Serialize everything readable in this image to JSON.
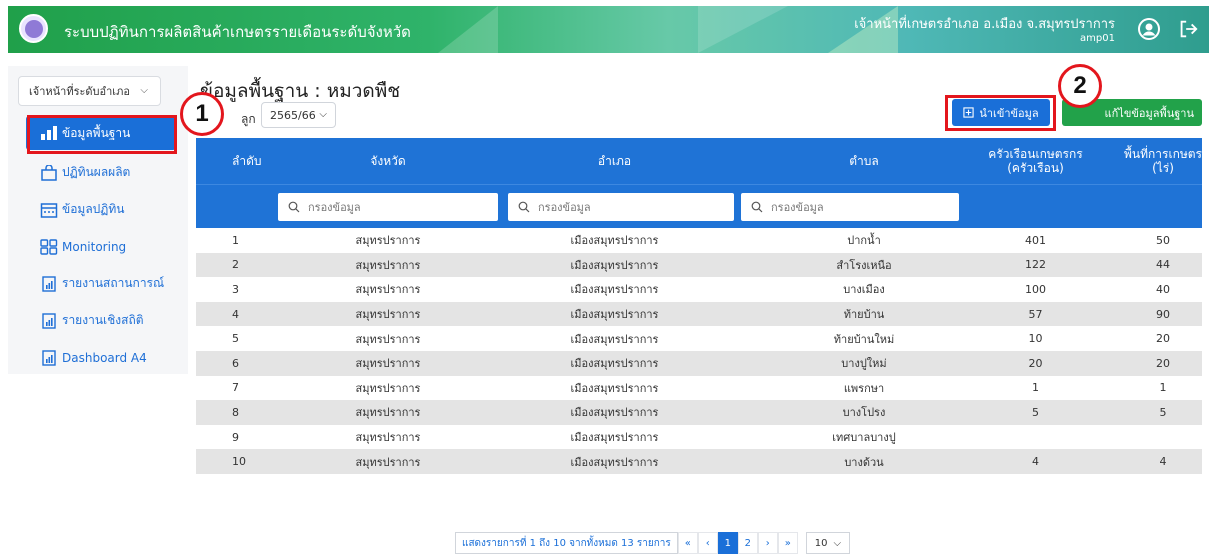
{
  "header": {
    "app_title": "ระบบปฏิทินการผลิตสินค้าเกษตรรายเดือนระดับจังหวัด",
    "user_name": "เจ้าหน้าที่เกษตรอำเภอ อ.เมือง จ.สมุทรปราการ",
    "user_id": "amp01"
  },
  "sidebar": {
    "role_select": "เจ้าหน้าที่ระดับอำเภอ",
    "items": [
      {
        "label": "ข้อมูลพื้นฐาน",
        "icon": "bar-chart-icon",
        "active": true
      },
      {
        "label": "ปฏิทินผลผลิต",
        "icon": "bag-icon"
      },
      {
        "label": "ข้อมูลปฏิทิน",
        "icon": "calendar-icon"
      },
      {
        "label": "Monitoring",
        "icon": "grid-icon"
      },
      {
        "label": "รายงานสถานการณ์",
        "icon": "report-icon"
      },
      {
        "label": "รายงานเชิงสถิติ",
        "icon": "report-icon"
      },
      {
        "label": "Dashboard A4",
        "icon": "report-icon"
      }
    ]
  },
  "main": {
    "title": "ข้อมูลพื้นฐาน : หมวดพืช",
    "year_label": "ลูก",
    "year_value": "2565/66",
    "import_button": "นำเข้าข้อมูล",
    "edit_button": "แก้ไขข้อมูลพื้นฐาน",
    "callout_1": "1",
    "callout_2": "2"
  },
  "table": {
    "headers": [
      "ลำดับ",
      "จังหวัด",
      "อำเภอ",
      "ตำบล",
      "ครัวเรือนเกษตรกร (ครัวเรือน)",
      "พื้นที่การเกษตร (ไร่)"
    ],
    "filter_placeholder": "กรองข้อมูล",
    "rows": [
      [
        "1",
        "สมุทรปราการ",
        "เมืองสมุทรปราการ",
        "ปากน้ำ",
        "401",
        "50"
      ],
      [
        "2",
        "สมุทรปราการ",
        "เมืองสมุทรปราการ",
        "สำโรงเหนือ",
        "122",
        "44"
      ],
      [
        "3",
        "สมุทรปราการ",
        "เมืองสมุทรปราการ",
        "บางเมือง",
        "100",
        "40"
      ],
      [
        "4",
        "สมุทรปราการ",
        "เมืองสมุทรปราการ",
        "ท้ายบ้าน",
        "57",
        "90"
      ],
      [
        "5",
        "สมุทรปราการ",
        "เมืองสมุทรปราการ",
        "ท้ายบ้านใหม่",
        "10",
        "20"
      ],
      [
        "6",
        "สมุทรปราการ",
        "เมืองสมุทรปราการ",
        "บางปูใหม่",
        "20",
        "20"
      ],
      [
        "7",
        "สมุทรปราการ",
        "เมืองสมุทรปราการ",
        "แพรกษา",
        "1",
        "1"
      ],
      [
        "8",
        "สมุทรปราการ",
        "เมืองสมุทรปราการ",
        "บางโปรง",
        "5",
        "5"
      ],
      [
        "9",
        "สมุทรปราการ",
        "เมืองสมุทรปราการ",
        "เทศบาลบางปู",
        "",
        ""
      ],
      [
        "10",
        "สมุทรปราการ",
        "เมืองสมุทรปราการ",
        "บางด้วน",
        "4",
        "4"
      ]
    ]
  },
  "pagination": {
    "info": "แสดงรายการที่ 1 ถึง 10 จากทั้งหมด 13 รายการ",
    "first": "«",
    "prev": "‹",
    "pages": [
      "1",
      "2"
    ],
    "next": "›",
    "last": "»",
    "per_page": "10"
  }
}
